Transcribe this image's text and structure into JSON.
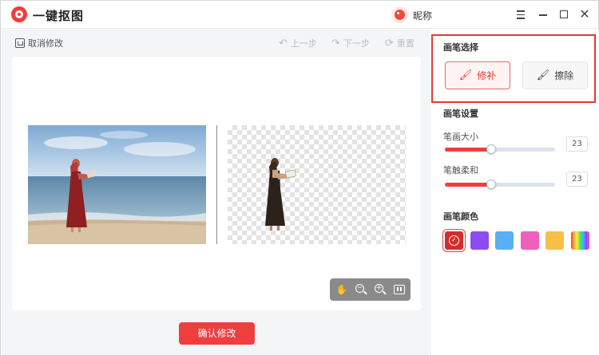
{
  "titlebar": {
    "app_title": "一键抠图",
    "nickname": "昵称",
    "menu_icon": "menu-icon",
    "close_glyph": "✕"
  },
  "toolbar": {
    "cancel_label": "取消修改",
    "undo_label": "上一步",
    "redo_label": "下一步",
    "reset_label": "重置",
    "undo_glyph": "↶",
    "redo_glyph": "↷",
    "reset_glyph": "⟳"
  },
  "editor": {
    "original_image": "beach-woman-reading-photo",
    "cutout_image": "beach-woman-cutout-transparent",
    "zoom_tools": [
      "hand-icon",
      "zoom-out-icon",
      "zoom-in-icon",
      "fit-screen-icon"
    ],
    "zoom_out_glyph": "−",
    "zoom_in_glyph": "+",
    "confirm_label": "确认修改"
  },
  "right_panel": {
    "brush_select_title": "画笔选择",
    "brush_repair_label": "修补",
    "brush_erase_label": "擦除",
    "brush_settings_title": "画笔设置",
    "size_label": "笔画大小",
    "size_value": "23",
    "size_fraction": 0.42,
    "softness_label": "笔触柔和",
    "softness_value": "23",
    "softness_fraction": 0.42,
    "color_title": "画笔颜色",
    "colors": [
      "#d92b2b",
      "#8c4cf2",
      "#5aaef5",
      "#ef5fbc",
      "#f5bf48",
      "rainbow"
    ],
    "selected_color_index": 0,
    "check_glyph": "✓"
  },
  "colors": {
    "accent": "#ef3e3e",
    "highlight_border": "#e53935"
  }
}
